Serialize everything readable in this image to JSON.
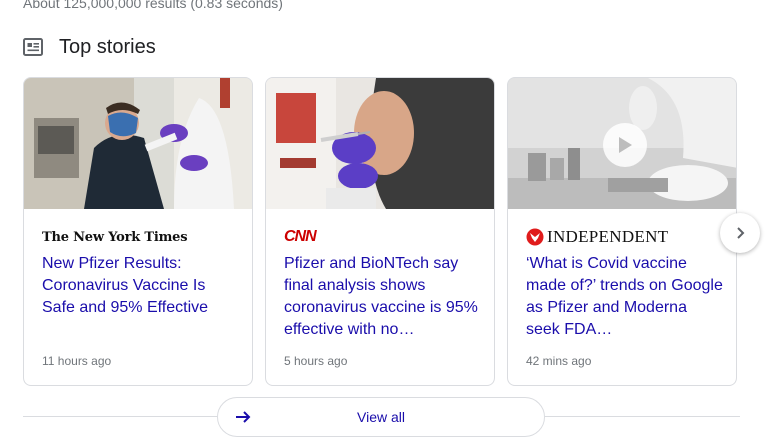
{
  "results_stats": "About 125,000,000 results (0.83 seconds)",
  "section": {
    "title": "Top stories",
    "icon": "news-icon"
  },
  "stories": [
    {
      "source": "The New York Times",
      "headline": "New Pfizer Results: Coronavirus Vaccine Is Safe and 95% Effective",
      "time": "11 hours ago"
    },
    {
      "source": "CNN",
      "headline": "Pfizer and BioNTech say final analysis shows coronavirus vaccine is 95% effective with no…",
      "time": "5 hours ago"
    },
    {
      "source": "INDEPENDENT",
      "headline": "‘What is Covid vaccine made of?’ trends on Google as Pfizer and Moderna seek FDA…",
      "time": "42 mins ago",
      "has_video": true
    }
  ],
  "view_all": {
    "label": "View all",
    "icon": "arrow-right-icon"
  },
  "next_icon": "chevron-right-icon",
  "colors": {
    "link": "#1a0dab",
    "meta": "#70757a",
    "cnn_red": "#cc0000",
    "independent_red": "#e01c1c"
  }
}
